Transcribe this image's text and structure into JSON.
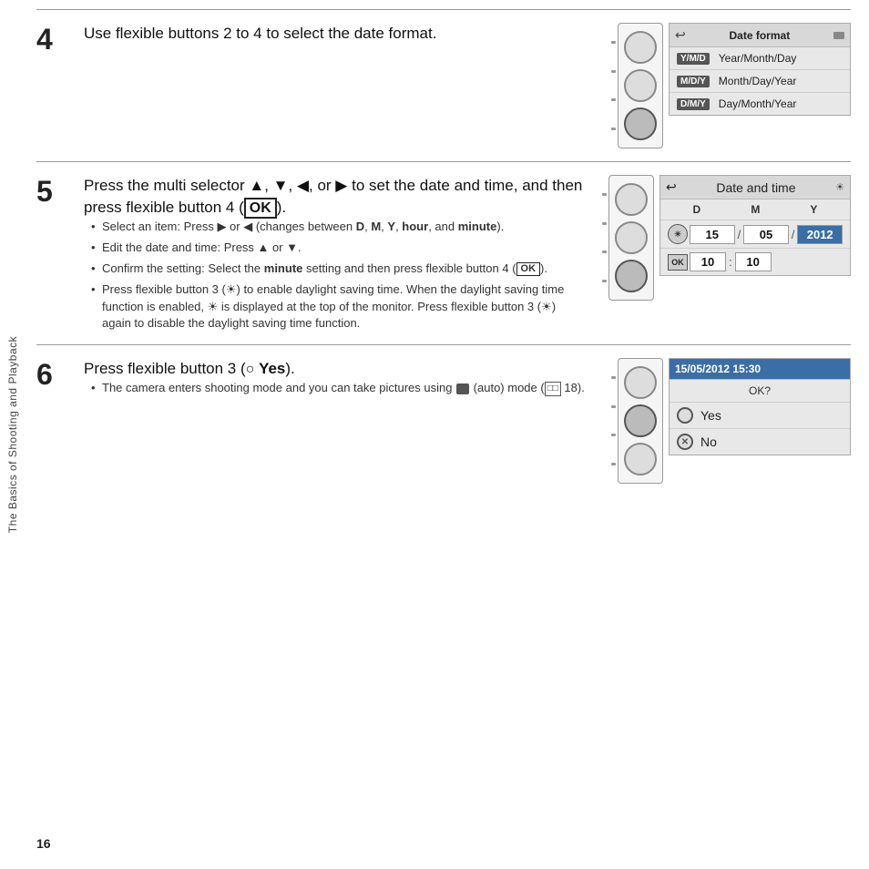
{
  "sidebar": {
    "text": "The Basics of Shooting and Playback"
  },
  "page_number": "16",
  "sections": [
    {
      "number": "4",
      "title": "Use flexible buttons 2 to 4 to select the date format.",
      "bullets": [],
      "screen": {
        "type": "date_format",
        "header": "Date format",
        "options": [
          {
            "tag": "Y/M/D",
            "label": "Year/Month/Day"
          },
          {
            "tag": "M/D/Y",
            "label": "Month/Day/Year"
          },
          {
            "tag": "D/M/Y",
            "label": "Day/Month/Year"
          }
        ]
      }
    },
    {
      "number": "5",
      "title": "Press the multi selector ▲, ▼, ◀, or ▶ to set the date and time, and then press flexible button 4 (OK).",
      "bullets": [
        "Select an item: Press ▶ or ◀ (changes between D, M, Y, hour, and minute).",
        "Edit the date and time: Press ▲ or ▼.",
        "Confirm the setting: Select the minute setting and then press flexible button 4 (OK).",
        "Press flexible button 3 (☀) to enable daylight saving time. When the daylight saving time function is enabled, ☀ is displayed at the top of the monitor. Press flexible button 3 (☀) again to disable the daylight saving time function."
      ],
      "screen": {
        "type": "datetime",
        "header": "Date and time",
        "dmy_labels": [
          "D",
          "M",
          "Y"
        ],
        "day": "15",
        "month": "05",
        "year": "2012",
        "hour": "10",
        "minute": "10"
      }
    },
    {
      "number": "6",
      "title": "Press flexible button 3 (○ Yes).",
      "bullets": [
        "The camera enters shooting mode and you can take pictures using  (auto) mode ( 18)."
      ],
      "screen": {
        "type": "confirm",
        "date_display": "15/05/2012 15:30",
        "question": "OK?",
        "yes_label": "Yes",
        "no_label": "No"
      }
    }
  ]
}
